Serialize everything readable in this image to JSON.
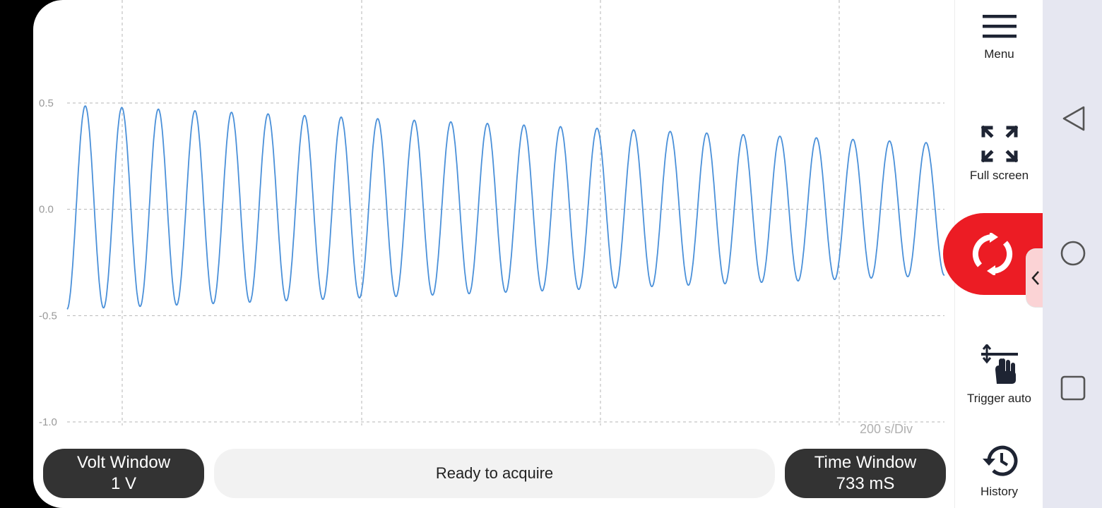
{
  "plot": {
    "y_ticks": [
      "0.5",
      "0.0",
      "-0.5",
      "-1.0"
    ],
    "time_per_div": "200 s/Div",
    "trace_color": "#4a90d9"
  },
  "chart_data": {
    "type": "line",
    "ylim": [
      -1.0,
      0.5
    ],
    "y_ticks": [
      0.5,
      0.0,
      -0.5,
      -1.0
    ],
    "grid": true,
    "waveform": "sine",
    "cycles_visible": 24,
    "peak_start": 0.49,
    "peak_end": 0.31,
    "trough_start": -0.47,
    "trough_end": -0.31
  },
  "bottom": {
    "volt_title": "Volt Window",
    "volt_value": "1 V",
    "status": "Ready to acquire",
    "time_title": "Time Window",
    "time_value": "733 mS"
  },
  "side": {
    "menu": "Menu",
    "full_screen": "Full screen",
    "trigger": "Trigger auto",
    "history": "History"
  },
  "colors": {
    "run_button": "#ec1c24",
    "pill_bg": "#333333",
    "status_bg": "#f2f2f2"
  },
  "icons": [
    "menu-icon",
    "fullscreen-icon",
    "refresh-icon",
    "chevron-left-icon",
    "trigger-hand-icon",
    "history-icon",
    "back-nav-icon",
    "home-nav-icon",
    "recents-nav-icon"
  ]
}
